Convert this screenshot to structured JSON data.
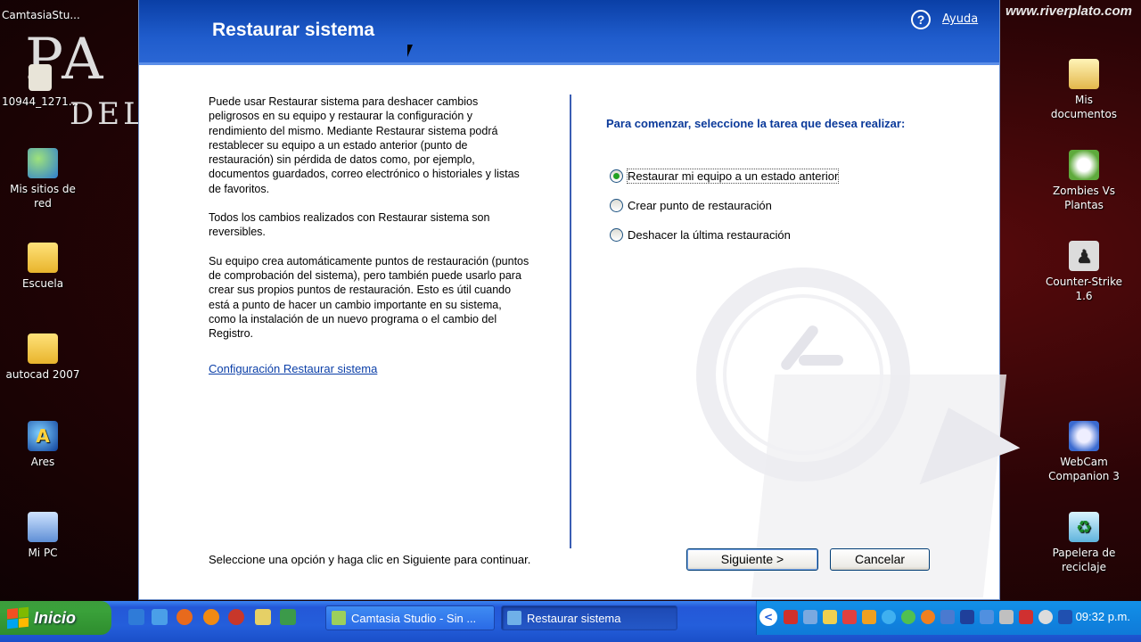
{
  "desktop": {
    "top_label": "CamtasiaStu...",
    "file_label": "10944_1271...",
    "wallpaper_text_top": "PA",
    "wallpaper_text_mid": "DEL",
    "wallpaper_brand": "www.riverplato.com",
    "left_icons": [
      {
        "label": "Mis sitios de red",
        "icon": "network-globe-icon"
      },
      {
        "label": "Escuela",
        "icon": "folder-icon"
      },
      {
        "label": "autocad 2007",
        "icon": "folder-icon"
      },
      {
        "label": "Ares",
        "icon": "ares-icon"
      },
      {
        "label": "Mi PC",
        "icon": "computer-icon"
      }
    ],
    "right_icons": [
      {
        "label": "Mis documentos",
        "icon": "documents-folder-icon"
      },
      {
        "label": "Zombies Vs Plantas",
        "icon": "zombies-game-icon"
      },
      {
        "label": "Counter-Strike 1.6",
        "icon": "counter-strike-icon"
      },
      {
        "label": "WebCam Companion 3",
        "icon": "webcam-icon"
      },
      {
        "label": "Papelera de reciclaje",
        "icon": "recycle-bin-icon"
      }
    ]
  },
  "window": {
    "title": "Restaurar sistema",
    "help_label": "Ayuda",
    "help_icon": "?",
    "intro_paragraphs": [
      "Puede usar Restaurar sistema para deshacer cambios peligrosos en su equipo y restaurar la configuración y rendimiento del mismo. Mediante Restaurar sistema podrá restablecer su equipo a un estado anterior (punto de restauración) sin pérdida de datos como, por ejemplo, documentos guardados, correo electrónico o historiales y listas de favoritos.",
      "Todos los cambios realizados con Restaurar sistema son reversibles.",
      "Su equipo crea automáticamente puntos de restauración (puntos de comprobación del sistema), pero también puede usarlo para crear sus propios puntos de restauración. Esto es útil cuando está a punto de hacer un cambio importante en su sistema, como la instalación de un nuevo programa o el cambio del Registro."
    ],
    "config_link": "Configuración Restaurar sistema",
    "prompt": "Para comenzar, seleccione la tarea que desea realizar:",
    "options": [
      {
        "label": "Restaurar mi equipo a un estado anterior",
        "checked": true
      },
      {
        "label": "Crear punto de restauración",
        "checked": false
      },
      {
        "label": "Deshacer la última restauración",
        "checked": false
      }
    ],
    "footer_text": "Seleccione una opción y haga clic en Siguiente para continuar.",
    "next_label": "Siguiente >",
    "cancel_label": "Cancelar"
  },
  "taskbar": {
    "start_label": "Inicio",
    "tasks": [
      {
        "label": "Camtasia Studio - Sin ..."
      },
      {
        "label": "Restaurar sistema"
      }
    ],
    "tray_arrow": "<",
    "clock": "09:32 p.m."
  }
}
